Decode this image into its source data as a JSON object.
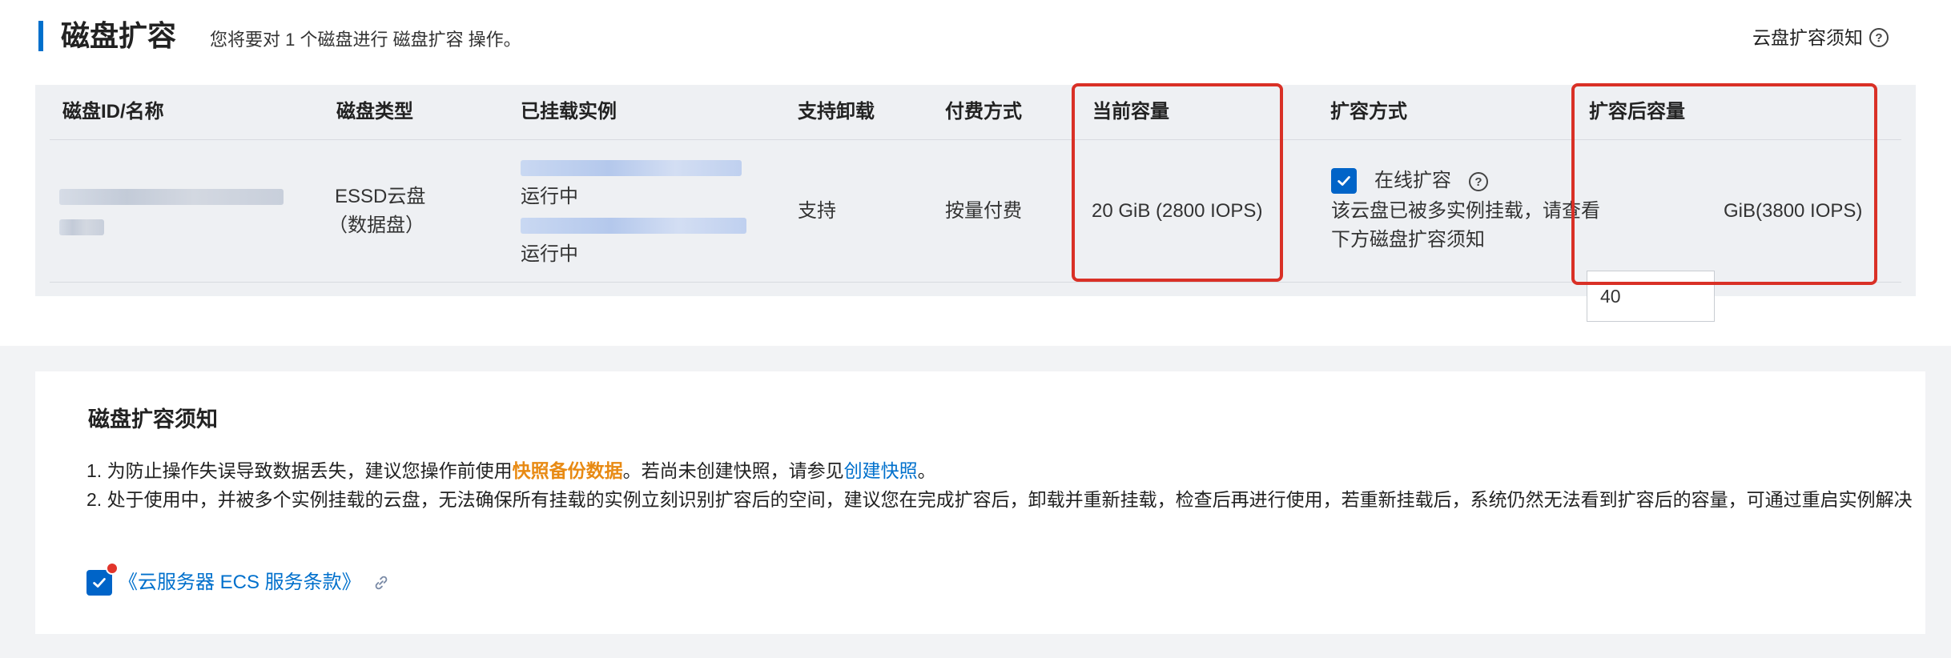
{
  "header": {
    "title": "磁盘扩容",
    "subtitle": "您将要对 1 个磁盘进行 磁盘扩容 操作。",
    "notice_link": "云盘扩容须知"
  },
  "table": {
    "columns": [
      "磁盘ID/名称",
      "磁盘类型",
      "已挂载实例",
      "支持卸载",
      "付费方式",
      "当前容量",
      "扩容方式",
      "扩容后容量"
    ],
    "row": {
      "disk_type_line1": "ESSD云盘",
      "disk_type_line2": "（数据盘）",
      "instance1_status": "运行中",
      "instance2_status": "运行中",
      "detachable": "支持",
      "billing": "按量付费",
      "current_capacity": "20 GiB (2800 IOPS)",
      "online_resize_label": "在线扩容",
      "online_resize_checked": true,
      "resize_note": "该云盘已被多实例挂载，请查看下方磁盘扩容须知",
      "new_capacity_value": "40",
      "new_capacity_unit": "GiB(3800 IOPS)"
    }
  },
  "notice": {
    "title": "磁盘扩容须知",
    "line1_prefix": "1. 为防止操作失误导致数据丢失，建议您操作前使用",
    "line1_highlight": "快照备份数据",
    "line1_middle": "。若尚未创建快照，请参见",
    "line1_link": "创建快照",
    "line1_suffix": "。",
    "line2": "2. 处于使用中，并被多个实例挂载的云盘，无法确保所有挂载的实例立刻识别扩容后的空间，建议您在完成扩容后，卸载并重新挂载，检查后再进行使用，若重新挂载后，系统仍然无法看到扩容后的容量，可通过重启实例解决",
    "terms_label": "《云服务器 ECS 服务条款》",
    "terms_checked": true
  },
  "colors": {
    "accent": "#0064c8",
    "highlight_orange": "#e88a13",
    "annotation_red": "#d93026"
  }
}
